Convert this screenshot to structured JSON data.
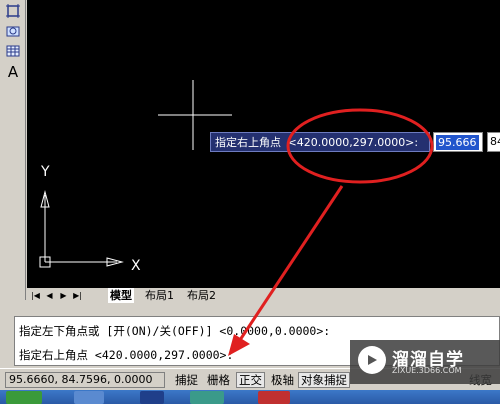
{
  "toolbar": {
    "items": [
      "block-icon",
      "region-icon",
      "table-icon",
      "text-icon"
    ],
    "text_tool_label": "A"
  },
  "canvas": {
    "ucs_y": "Y",
    "ucs_x": "X"
  },
  "dynamic_input": {
    "prompt": "指定右上角点",
    "default_value": "<420.0000,297.0000>:",
    "field1_value": "95.666",
    "field2_value": "84"
  },
  "tabs": {
    "nav": [
      "|◀",
      "◀",
      "▶",
      "▶|"
    ],
    "items": [
      "模型",
      "布局1",
      "布局2"
    ]
  },
  "command_window": {
    "line1": "指定左下角点或 [开(ON)/关(OFF)] <0.0000,0.0000>:",
    "line2": "指定右上角点 <420.0000,297.0000>:"
  },
  "status_bar": {
    "coords": "95.6660,  84.7596, 0.0000",
    "buttons": [
      "捕捉",
      "栅格",
      "正交",
      "极轴",
      "对象捕捉",
      "线宽"
    ]
  },
  "watermark": {
    "title": "溜溜自学",
    "url": "ZIXUE.3D66.COM"
  },
  "colors": {
    "canvas_bg": "#000000",
    "annotation": "#e02020",
    "prompt_bg": "#243070"
  }
}
